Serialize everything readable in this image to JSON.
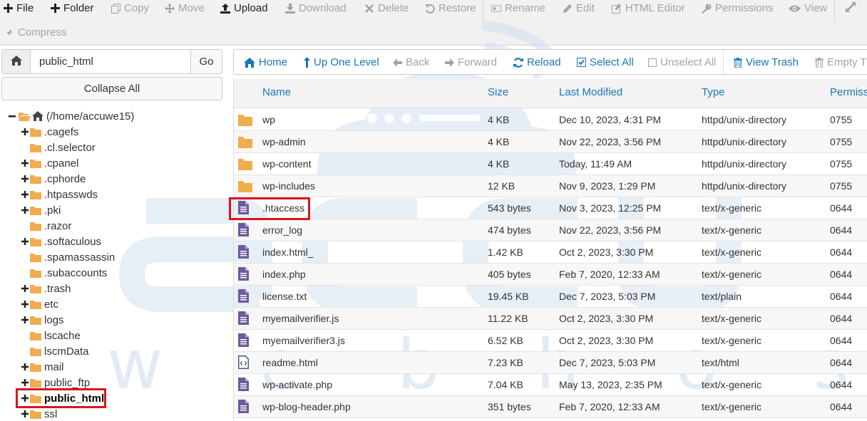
{
  "toolbar": {
    "file": "File",
    "folder": "Folder",
    "copy": "Copy",
    "move": "Move",
    "upload": "Upload",
    "download": "Download",
    "delete": "Delete",
    "restore": "Restore",
    "rename": "Rename",
    "edit": "Edit",
    "html_editor": "HTML Editor",
    "permissions": "Permissions",
    "view": "View",
    "compress": "Compress"
  },
  "path": {
    "value": "public_html",
    "go": "Go",
    "collapse_all": "Collapse All"
  },
  "tree": {
    "root": "(/home/accuwe15)",
    "items": [
      {
        "label": ".cagefs",
        "expandable": true
      },
      {
        "label": ".cl.selector",
        "expandable": false
      },
      {
        "label": ".cpanel",
        "expandable": true
      },
      {
        "label": ".cphorde",
        "expandable": true
      },
      {
        "label": ".htpasswds",
        "expandable": true
      },
      {
        "label": ".pki",
        "expandable": true
      },
      {
        "label": ".razor",
        "expandable": false
      },
      {
        "label": ".softaculous",
        "expandable": true
      },
      {
        "label": ".spamassassin",
        "expandable": false
      },
      {
        "label": ".subaccounts",
        "expandable": false
      },
      {
        "label": ".trash",
        "expandable": true
      },
      {
        "label": "etc",
        "expandable": true
      },
      {
        "label": "logs",
        "expandable": true
      },
      {
        "label": "lscache",
        "expandable": false
      },
      {
        "label": "lscmData",
        "expandable": false
      },
      {
        "label": "mail",
        "expandable": true
      },
      {
        "label": "public_ftp",
        "expandable": true
      },
      {
        "label": "public_html",
        "expandable": true,
        "current": true
      },
      {
        "label": "ssl",
        "expandable": true
      }
    ]
  },
  "nav": {
    "home": "Home",
    "up_one_level": "Up One Level",
    "back": "Back",
    "forward": "Forward",
    "reload": "Reload",
    "select_all": "Select All",
    "unselect_all": "Unselect All",
    "view_trash": "View Trash",
    "empty_trash": "Empty Tr"
  },
  "table": {
    "columns": {
      "name": "Name",
      "size": "Size",
      "last_modified": "Last Modified",
      "type": "Type",
      "permissions": "Permissi"
    },
    "rows": [
      {
        "icon": "folder",
        "name": "wp",
        "size": "4 KB",
        "modified": "Dec 10, 2023, 4:31 PM",
        "type": "httpd/unix-directory",
        "perms": "0755"
      },
      {
        "icon": "folder",
        "name": "wp-admin",
        "size": "4 KB",
        "modified": "Nov 22, 2023, 3:56 PM",
        "type": "httpd/unix-directory",
        "perms": "0755"
      },
      {
        "icon": "folder",
        "name": "wp-content",
        "size": "4 KB",
        "modified": "Today, 11:49 AM",
        "type": "httpd/unix-directory",
        "perms": "0755"
      },
      {
        "icon": "folder",
        "name": "wp-includes",
        "size": "12 KB",
        "modified": "Nov 9, 2023, 1:29 PM",
        "type": "httpd/unix-directory",
        "perms": "0755"
      },
      {
        "icon": "file",
        "name": ".htaccess",
        "size": "543 bytes",
        "modified": "Nov 3, 2023, 12:25 PM",
        "type": "text/x-generic",
        "perms": "0644",
        "highlight": true
      },
      {
        "icon": "file",
        "name": "error_log",
        "size": "474 bytes",
        "modified": "Nov 22, 2023, 3:56 PM",
        "type": "text/x-generic",
        "perms": "0644"
      },
      {
        "icon": "file",
        "name": "index.html_",
        "size": "1.42 KB",
        "modified": "Oct 2, 2023, 3:30 PM",
        "type": "text/x-generic",
        "perms": "0644"
      },
      {
        "icon": "file",
        "name": "index.php",
        "size": "405 bytes",
        "modified": "Feb 7, 2020, 12:33 AM",
        "type": "text/x-generic",
        "perms": "0644"
      },
      {
        "icon": "file",
        "name": "license.txt",
        "size": "19.45 KB",
        "modified": "Dec 7, 2023, 5:03 PM",
        "type": "text/plain",
        "perms": "0644"
      },
      {
        "icon": "file",
        "name": "myemailverifier.js",
        "size": "11.22 KB",
        "modified": "Oct 2, 2023, 3:30 PM",
        "type": "text/x-generic",
        "perms": "0644"
      },
      {
        "icon": "file",
        "name": "myemailverifier3.js",
        "size": "6.52 KB",
        "modified": "Oct 2, 2023, 3:30 PM",
        "type": "text/x-generic",
        "perms": "0644"
      },
      {
        "icon": "html",
        "name": "readme.html",
        "size": "7.23 KB",
        "modified": "Dec 7, 2023, 5:03 PM",
        "type": "text/html",
        "perms": "0644"
      },
      {
        "icon": "file",
        "name": "wp-activate.php",
        "size": "7.04 KB",
        "modified": "May 13, 2023, 2:35 PM",
        "type": "text/x-generic",
        "perms": "0644"
      },
      {
        "icon": "file",
        "name": "wp-blog-header.php",
        "size": "351 bytes",
        "modified": "Feb 7, 2020, 12:33 AM",
        "type": "text/x-generic",
        "perms": "0644"
      }
    ]
  },
  "watermark": {
    "text": "w e b   h o s t i n g"
  },
  "colors": {
    "link": "#1976b7",
    "folder": "#f0ad4e",
    "file_icon": "#6e5a9e",
    "highlight": "#d9161e"
  }
}
